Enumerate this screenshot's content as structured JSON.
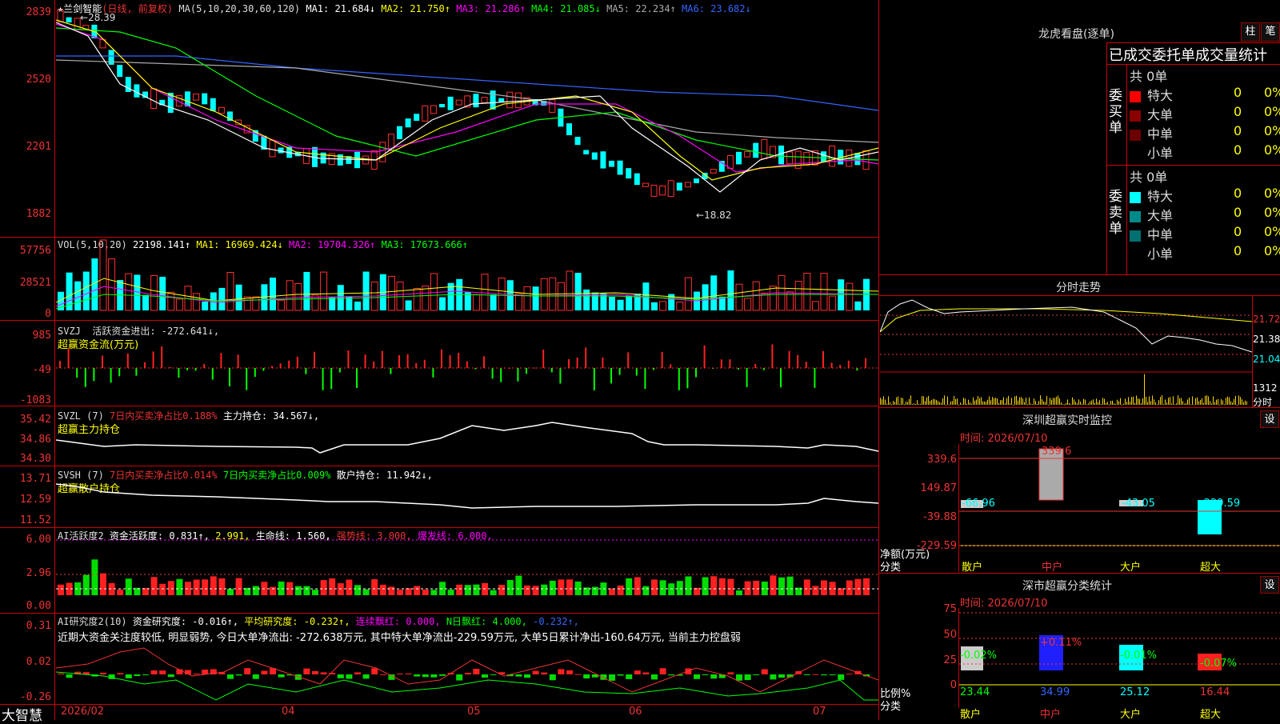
{
  "stock": {
    "name": "兰剑智能",
    "mode": "(日线, 前复权)"
  },
  "ma_line": {
    "label": "MA(5,10,20,30,60,120)",
    "ma1": "MA1: 21.684↓",
    "ma2": "MA2: 21.750↑",
    "ma3": "MA3: 21.286↑",
    "ma4": "MA4: 21.085↓",
    "ma5": "MA5: 22.234↑",
    "ma6": "MA6: 23.682↓"
  },
  "price_axis": [
    "2839",
    "2520",
    "2201",
    "1882"
  ],
  "price_marks": {
    "high": "28.39",
    "low": "18.82"
  },
  "vol": {
    "label": "VOL(5,10,20)",
    "value": "22198.141↑",
    "ma1": "MA1: 16969.424↓",
    "ma2": "MA2: 19704.326↑",
    "ma3": "MA3: 17673.666↑",
    "axis": [
      "57756",
      "28521",
      "0"
    ]
  },
  "svzj": {
    "label": "SVZJ",
    "text": "活跃资金进出: -272.641↓,",
    "sub": "超赢资金流(万元)",
    "axis": [
      "985",
      "-49",
      "-1083"
    ]
  },
  "svzl": {
    "label": "SVZL (7)",
    "t1": "7日内买卖净占比0.188%",
    "t2": "主力持仓: 34.567↓,",
    "sub": "超赢主力持仓",
    "axis": [
      "35.42",
      "34.86",
      "34.30"
    ]
  },
  "svsh": {
    "label": "SVSH (7)",
    "t1": "7日内买卖净占比0.014%",
    "t2": "7日内买卖净占比0.009%",
    "t3": "散户持仓: 11.942↓,",
    "sub": "超赢散户持仓",
    "axis": [
      "13.71",
      "12.59",
      "11.52"
    ]
  },
  "ai1": {
    "label": "AI活跃度2",
    "t1": "资金活跃度: 0.831↑,",
    "t2": "2.991,",
    "t3": "生命线: 1.560,",
    "t4": "强势线: 3.000,",
    "t5": "爆发线: 6.000,",
    "axis": [
      "6.00",
      "2.96",
      "0.00"
    ]
  },
  "ai2": {
    "label": "AI研究度2(10)",
    "t1": "资金研究度: -0.016↑,",
    "t2": "平均研究度: -0.232↑,",
    "t3": "连续飘红: 0.000,",
    "t4": "N日飘红: 4.000,",
    "t5": "-0.232↑,",
    "comment": "近期大资金关注度较低, 明显弱势, 今日大单净流出: -272.638万元, 其中特大单净流出-229.59万元, 大单5日累计净出-160.64万元, 当前主力控盘弱",
    "axis": [
      "0.31",
      "0.02",
      "-0.26"
    ]
  },
  "date_axis": [
    "2026/02",
    "04",
    "05",
    "06",
    "07"
  ],
  "brand": "大智慧",
  "right": {
    "title": "龙虎看盘(逐单)",
    "btn1": "柱",
    "btn2": "笔",
    "tabs": "已成交委托单成交量统计",
    "buy_label": "委买单",
    "sell_label": "委卖单",
    "buy_total": "共 0单",
    "sell_total": "共 0单",
    "cats": [
      "特大",
      "大单",
      "中单",
      "小单"
    ],
    "vals": [
      "0",
      "0",
      "0",
      "0"
    ],
    "pcts": [
      "0%",
      "0%",
      "0%",
      "0%"
    ],
    "buy_colors": [
      "#ff0000",
      "#8b0000",
      "#6b0000",
      "#000000"
    ],
    "sell_colors": [
      "#00ffff",
      "#008b8b",
      "#007070",
      "#000000"
    ],
    "intraday_title": "分时走势",
    "intraday_axis": [
      "21.72",
      "21.38",
      "21.04"
    ],
    "intraday_vol": "1312",
    "intraday_unit": "分时",
    "monitor_title": "深圳超赢实时监控",
    "monitor_btn": "设",
    "monitor_time": "时间: 2026/07/10",
    "monitor_axis": [
      "339.6",
      "149.87",
      "-39.88",
      "-229.59"
    ],
    "monitor_vals": [
      "-66.96",
      "339.6",
      "-43.05",
      "-229.59"
    ],
    "monitor_net": "净额(万元)",
    "monitor_cls": "分类",
    "cats2": [
      "散户",
      "中户",
      "大户",
      "超大"
    ],
    "stat_title": "深市超赢分类统计",
    "stat_btn": "设",
    "stat_time": "时间: 2026/07/10",
    "stat_axis": [
      "75",
      "50",
      "25",
      "0"
    ],
    "stat_pcts": [
      "-0.02%",
      "+0.11%",
      "-0.01%",
      "-0.07%"
    ],
    "stat_vals": [
      "23.44",
      "34.99",
      "25.12",
      "16.44"
    ],
    "stat_ratio": "比例%",
    "stat_cls": "分类"
  }
}
